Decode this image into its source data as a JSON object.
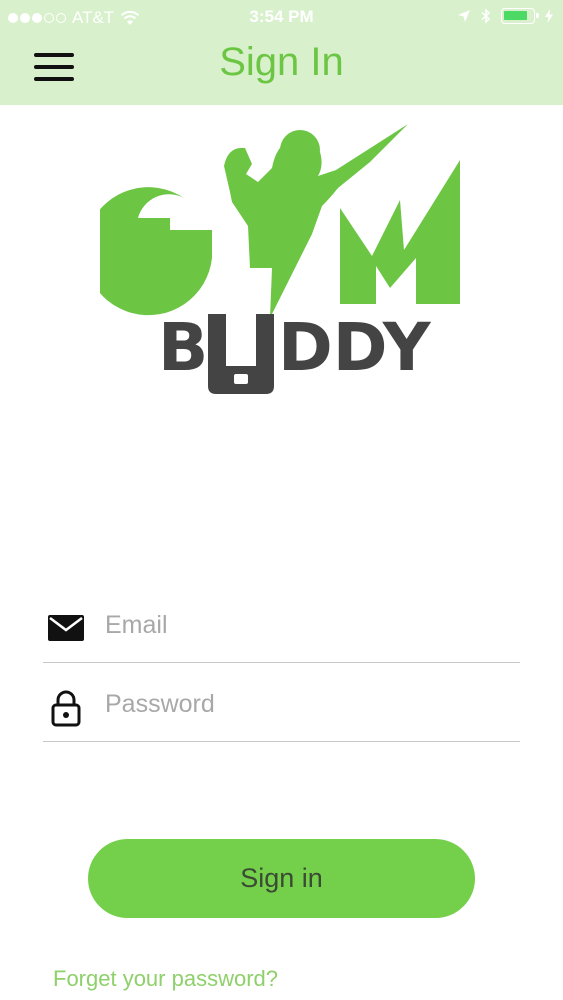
{
  "status_bar": {
    "carrier": "AT&T",
    "time": "3:54 PM",
    "battery_level": 0.85,
    "battery_color": "#4cd964"
  },
  "header": {
    "title": "Sign In",
    "menu_icon": "hamburger-menu-icon",
    "background_color": "#d8f1cc",
    "title_color": "#6cc644"
  },
  "logo": {
    "primary_text": "GYM",
    "secondary_text": "BUDDY",
    "primary_color": "#6cc644",
    "secondary_color": "#444444"
  },
  "form": {
    "email": {
      "placeholder": "Email",
      "value": "",
      "icon": "envelope-icon"
    },
    "password": {
      "placeholder": "Password",
      "value": "",
      "icon": "lock-icon"
    },
    "submit_label": "Sign in",
    "forgot_label": "Forget your password?",
    "accent_color": "#74d04a"
  }
}
